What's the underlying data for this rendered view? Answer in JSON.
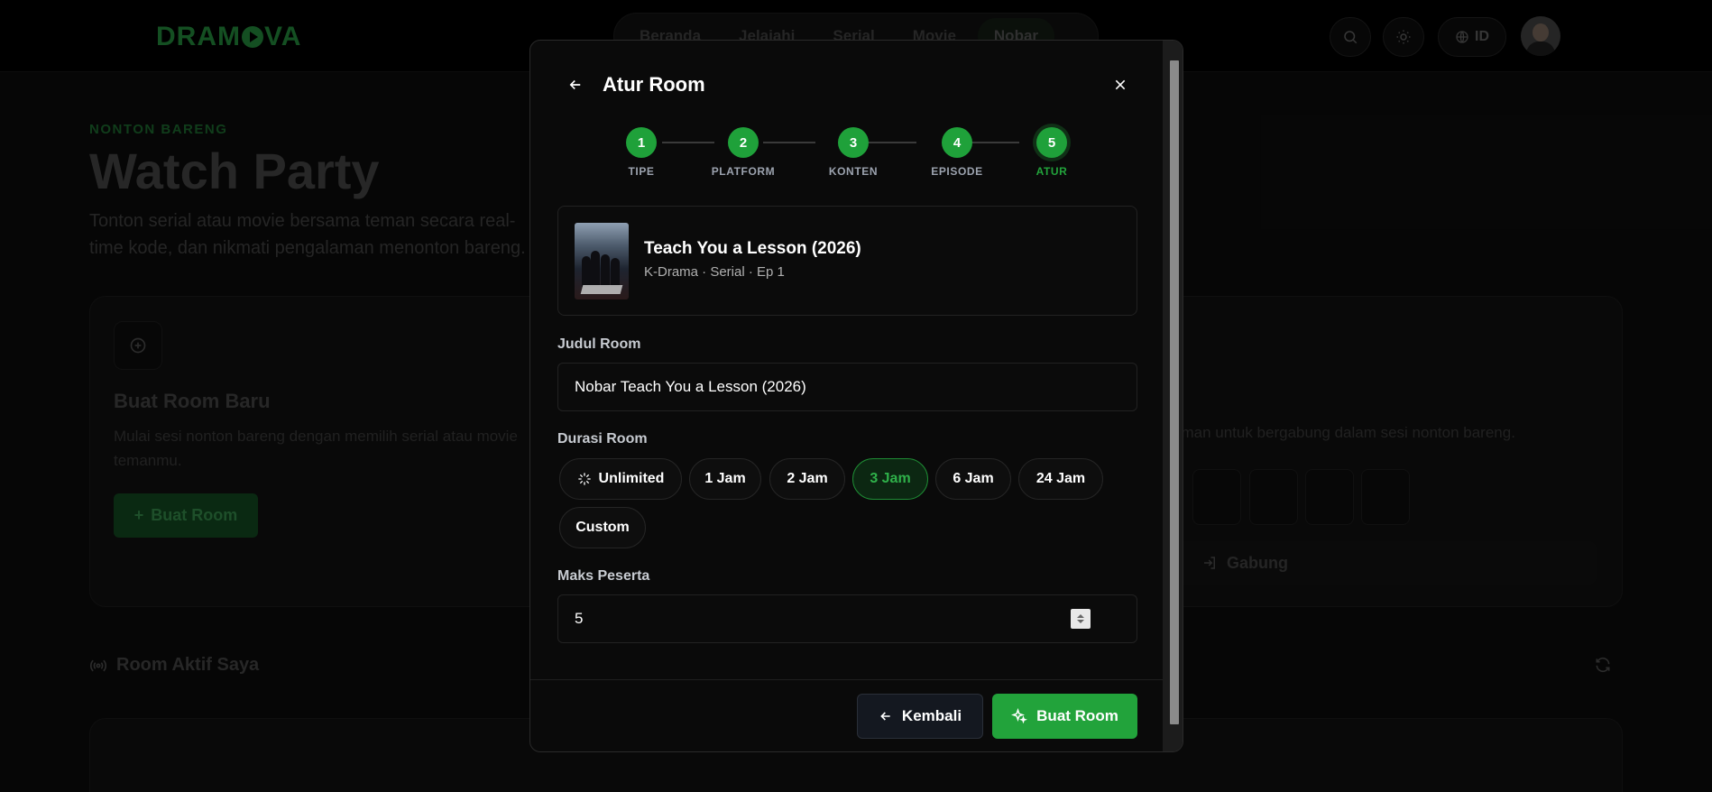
{
  "background": {
    "logo": "DRAMOVA",
    "nav": [
      "Beranda",
      "Jelajahi",
      "Serial",
      "Movie",
      "Nobar"
    ],
    "nav_active": "Nobar",
    "lang": "ID",
    "eyebrow": "NONTON BARENG",
    "title": "Watch Party",
    "description": "Tonton serial atau movie bersama teman secara real-time kode, dan nikmati pengalaman menonton bareng.",
    "create_card": {
      "title": "Buat Room Baru",
      "description": "Mulai sesi nonton bareng dengan memilih serial atau movie temanmu.",
      "button": "Buat Room"
    },
    "join_card": {
      "description": "eman untuk bergabung dalam sesi nonton bareng.",
      "button": "Gabung"
    },
    "active_rooms_title": "Room Aktif Saya"
  },
  "modal": {
    "title": "Atur Room",
    "steps": [
      {
        "num": "1",
        "label": "TIPE"
      },
      {
        "num": "2",
        "label": "PLATFORM"
      },
      {
        "num": "3",
        "label": "KONTEN"
      },
      {
        "num": "4",
        "label": "EPISODE"
      },
      {
        "num": "5",
        "label": "ATUR"
      }
    ],
    "current_step": 5,
    "content": {
      "title": "Teach You a Lesson (2026)",
      "meta": "K-Drama · Serial · Ep 1"
    },
    "room_title_label": "Judul Room",
    "room_title_value": "Nobar Teach You a Lesson (2026)",
    "duration_label": "Durasi Room",
    "durations": [
      "Unlimited",
      "1 Jam",
      "2 Jam",
      "3 Jam",
      "6 Jam",
      "24 Jam",
      "Custom"
    ],
    "duration_selected": "3 Jam",
    "max_label": "Maks Peserta",
    "max_value": "5",
    "back_button": "Kembali",
    "create_button": "Buat Room",
    "accent_color": "#22a33b"
  }
}
